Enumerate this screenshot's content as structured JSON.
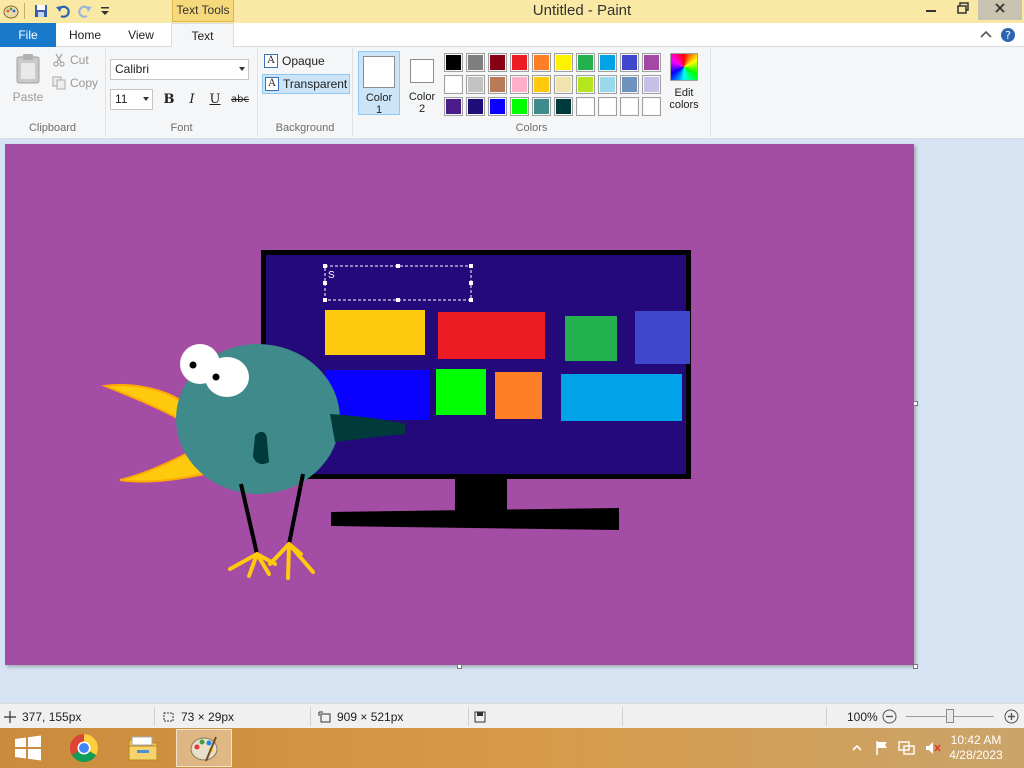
{
  "titlebar": {
    "context_tab": "Text Tools",
    "title": "Untitled - Paint",
    "buttons": [
      "minimize",
      "restore",
      "close"
    ]
  },
  "tabs": {
    "file": "File",
    "home": "Home",
    "view": "View",
    "text": "Text"
  },
  "clipboard": {
    "paste": "Paste",
    "cut": "Cut",
    "copy": "Copy",
    "label": "Clipboard"
  },
  "font": {
    "family": "Calibri",
    "size": "11",
    "bold": "B",
    "italic": "I",
    "underline": "U",
    "strikethrough": "abc",
    "label": "Font"
  },
  "background": {
    "opaque": "Opaque",
    "transparent": "Transparent",
    "selected": "Transparent",
    "label": "Background"
  },
  "colors": {
    "color1_label": "Color",
    "color1_num": "1",
    "color2_label": "Color",
    "color2_num": "2",
    "color1_value": "#ffffff",
    "color2_value": "#ffffff",
    "edit_label_1": "Edit",
    "edit_label_2": "colors",
    "label": "Colors",
    "palette": [
      "#000000",
      "#7f7f7f",
      "#880015",
      "#ed1c24",
      "#ff7f27",
      "#fff200",
      "#22b14c",
      "#00a2e8",
      "#3f48cc",
      "#a349a4",
      "#ffffff",
      "#c3c3c3",
      "#b97a57",
      "#ffaec9",
      "#ffc90e",
      "#efe4b0",
      "#b5e61d",
      "#99d9ea",
      "#7092be",
      "#c8bfe7",
      "#4b1b8a",
      "#1e0e7a",
      "#0a00ff",
      "#00ff00",
      "#3f8a8a",
      "#003a3a",
      "#ffffff",
      "#ffffff",
      "#ffffff",
      "#ffffff"
    ]
  },
  "canvas": {
    "background": "#a34da4",
    "text_box_content": "S"
  },
  "statusbar": {
    "cursor_pos": "377, 155px",
    "selection_size": "73 × 29px",
    "image_size": "909 × 521px",
    "zoom": "100%"
  },
  "taskbar": {
    "time": "10:42 AM",
    "date": "4/28/2023"
  }
}
